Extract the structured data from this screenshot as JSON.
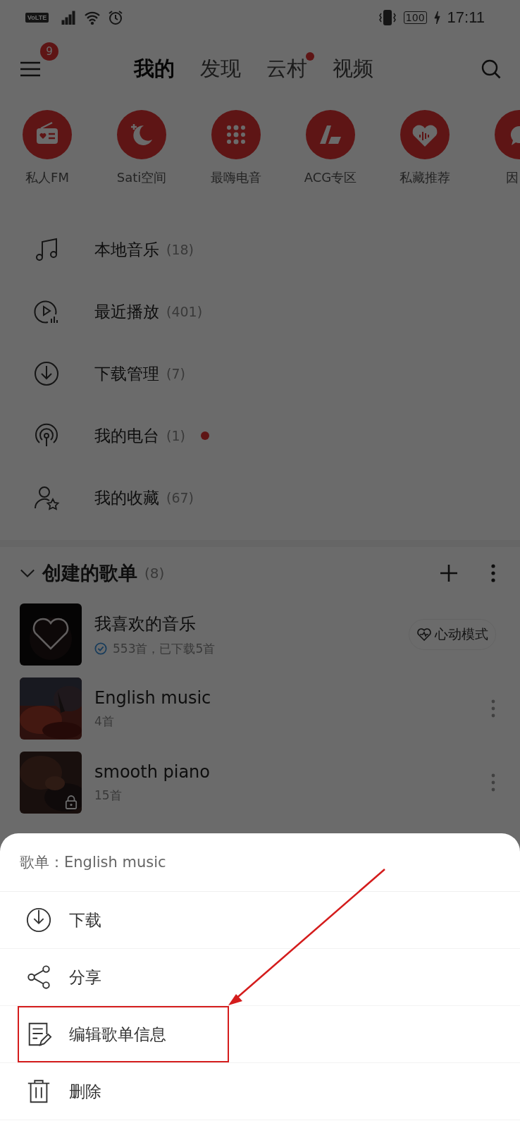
{
  "status_bar": {
    "network": "VoLTE",
    "battery": "100",
    "time": "17:11"
  },
  "header": {
    "menu_badge": "9",
    "tabs": [
      {
        "label": "我的",
        "selected": true,
        "dot": false
      },
      {
        "label": "发现",
        "selected": false,
        "dot": false
      },
      {
        "label": "云村",
        "selected": false,
        "dot": true
      },
      {
        "label": "视频",
        "selected": false,
        "dot": false
      }
    ]
  },
  "shortcuts": [
    {
      "label": "私人FM",
      "kind": "radio"
    },
    {
      "label": "Sati空间",
      "kind": "moon"
    },
    {
      "label": "最嗨电音",
      "kind": "dots"
    },
    {
      "label": "ACG专区",
      "kind": "acg"
    },
    {
      "label": "私藏推荐",
      "kind": "heart"
    },
    {
      "label": "因",
      "kind": "bubble"
    }
  ],
  "library": [
    {
      "label": "本地音乐",
      "count": "(18)",
      "kind": "note",
      "dot": false
    },
    {
      "label": "最近播放",
      "count": "(401)",
      "kind": "recent",
      "dot": false
    },
    {
      "label": "下载管理",
      "count": "(7)",
      "kind": "download",
      "dot": false
    },
    {
      "label": "我的电台",
      "count": "(1)",
      "kind": "radio",
      "dot": true
    },
    {
      "label": "我的收藏",
      "count": "(67)",
      "kind": "favorite",
      "dot": false
    }
  ],
  "playlist_section": {
    "title": "创建的歌单",
    "count": "(8)",
    "expanded": true
  },
  "playlists": [
    {
      "title": "我喜欢的音乐",
      "subtitle": "553首，已下载5首",
      "kind": "liked",
      "downloaded": true,
      "locked": false,
      "mode_button": "心动模式"
    },
    {
      "title": "English music",
      "subtitle": "4首",
      "kind": "normal",
      "downloaded": false,
      "locked": false
    },
    {
      "title": "smooth piano",
      "subtitle": "15首",
      "kind": "normal",
      "downloaded": false,
      "locked": true
    }
  ],
  "sheet": {
    "title": "歌单：English music",
    "items": [
      {
        "label": "下载",
        "kind": "download",
        "highlighted": false
      },
      {
        "label": "分享",
        "kind": "share",
        "highlighted": false
      },
      {
        "label": "编辑歌单信息",
        "kind": "edit",
        "highlighted": true
      },
      {
        "label": "删除",
        "kind": "delete",
        "highlighted": false
      }
    ]
  }
}
